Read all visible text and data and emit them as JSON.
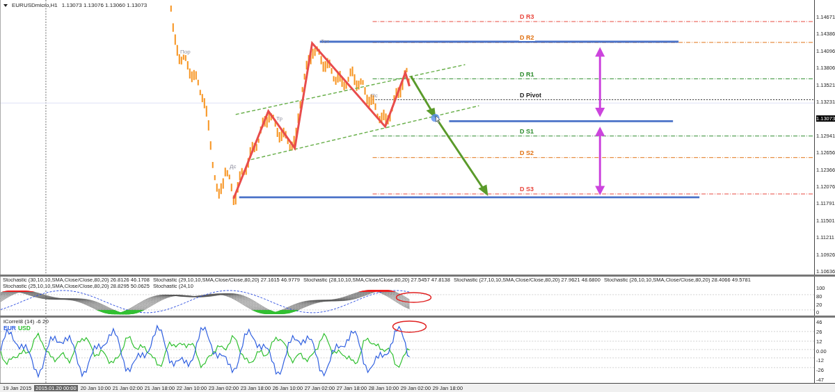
{
  "header": {
    "symbol": "EURUSDmicro,H1",
    "ohlc": "1.13073 1.13076 1.13060 1.13073"
  },
  "price_axis": {
    "ticks": [
      {
        "label": "1.14671",
        "current": false
      },
      {
        "label": "1.14386",
        "current": false
      },
      {
        "label": "1.14096",
        "current": false
      },
      {
        "label": "1.13806",
        "current": false
      },
      {
        "label": "1.13521",
        "current": false
      },
      {
        "label": "1.13231",
        "current": false
      },
      {
        "label": "1.13073",
        "current": true
      },
      {
        "label": "1.12941",
        "current": false
      },
      {
        "label": "1.12656",
        "current": false
      },
      {
        "label": "1.12366",
        "current": false
      },
      {
        "label": "1.12076",
        "current": false
      },
      {
        "label": "1.11791",
        "current": false
      },
      {
        "label": "1.11501",
        "current": false
      },
      {
        "label": "1.11211",
        "current": false
      },
      {
        "label": "1.10926",
        "current": false
      },
      {
        "label": "1.10636",
        "current": false
      }
    ]
  },
  "pivot_levels": [
    {
      "label": "D R3",
      "color": "#e8453c"
    },
    {
      "label": "D R2",
      "color": "#e07010"
    },
    {
      "label": "D R1",
      "color": "#2a8a2a"
    },
    {
      "label": "D Pivot",
      "color": "#222222"
    },
    {
      "label": "D S1",
      "color": "#2a8a2a"
    },
    {
      "label": "D S2",
      "color": "#e07010"
    },
    {
      "label": "D S3",
      "color": "#e8453c"
    }
  ],
  "pattern_labels": [
    "Пор",
    "Тст",
    "Тр",
    "Пс",
    "Дс"
  ],
  "stochastic": {
    "headers": [
      "Stochastic (30,10,10,SMA,Close/Close,80,20) 26.8126 46.1708",
      "Stochastic (29,10,10,SMA,Close/Close,80,20) 27.1615 46.9779",
      "Stochastic (28,10,10,SMA,Close/Close,80,20) 27.5457 47.8138",
      "Stochastic (27,10,10,SMA,Close/Close,80,20) 27.9621 48.6800",
      "Stochastic (26,10,10,SMA,Close/Close,80,20) 28.4066 49.5781",
      "Stochastic (25,10,10,SMA,Close/Close,80,20) 28.8295 50.0625",
      "Stochastic (24,10"
    ],
    "ticks": [
      "100",
      "80",
      "20",
      "0"
    ]
  },
  "correl": {
    "header": "iCorrel8 (14) -6 20",
    "legend": [
      {
        "label": "EUR",
        "color": "#3060e0"
      },
      {
        "label": "USD",
        "color": "#30c030"
      }
    ],
    "ticks": [
      "46",
      "26",
      "12",
      "0.00",
      "-12",
      "-26",
      "-47"
    ]
  },
  "time_axis": {
    "first": "19 Jan 2015",
    "crosshair": "2015.01.20 00:00",
    "labels": [
      "20 Jan 10:00",
      "21 Jan 02:00",
      "21 Jan 18:00",
      "22 Jan 10:00",
      "23 Jan 02:00",
      "23 Jan 18:00",
      "26 Jan 10:00",
      "27 Jan 02:00",
      "27 Jan 18:00",
      "28 Jan 10:00",
      "29 Jan 02:00",
      "29 Jan 18:00"
    ]
  }
}
